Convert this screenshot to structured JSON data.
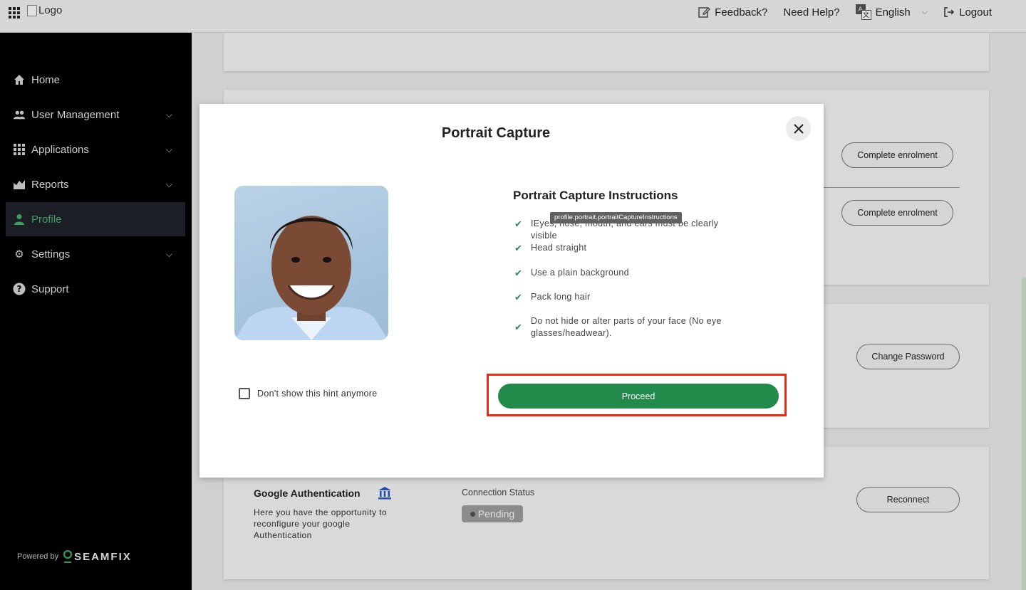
{
  "topbar": {
    "logo_alt": "Logo",
    "feedback": "Feedback?",
    "help": "Need Help?",
    "language": "English",
    "logout": "Logout"
  },
  "sidebar": {
    "items": [
      {
        "label": "Home",
        "icon": "home-icon"
      },
      {
        "label": "User Management",
        "icon": "people-icon"
      },
      {
        "label": "Applications",
        "icon": "apps-icon"
      },
      {
        "label": "Reports",
        "icon": "reports-icon"
      },
      {
        "label": "Profile",
        "icon": "person-icon",
        "active": true
      },
      {
        "label": "Settings",
        "icon": "gear-icon"
      },
      {
        "label": "Support",
        "icon": "help-icon"
      }
    ],
    "powered_by": "Powered by",
    "brand": "SEAMFIX"
  },
  "background": {
    "complete_enrolment_1": "Complete enrolment",
    "complete_enrolment_2": "Complete enrolment",
    "change_password": "Change Password",
    "google_auth_title": "Google Authentication",
    "google_auth_desc": "Here you have the opportunity to reconfigure your google Authentication",
    "connection_status_label": "Connection Status",
    "connection_status": "Pending",
    "reconnect": "Reconnect"
  },
  "modal": {
    "title": "Portrait Capture",
    "instructions_title": "Portrait Capture Instructions",
    "tooltip": "profile.portrait.portraitCaptureInstructions",
    "instructions": [
      "IEyes, nose, mouth, and ears must be clearly visible",
      "Head straight",
      "Use a plain background",
      "Pack long hair",
      "Do not hide or alter parts of your face (No eye glasses/headwear)."
    ],
    "hint_checkbox": "Don't show this hint anymore",
    "proceed": "Proceed"
  },
  "colors": {
    "accent": "#228b4b",
    "highlight": "#ee2b10",
    "sidebar_bg": "#000000"
  }
}
